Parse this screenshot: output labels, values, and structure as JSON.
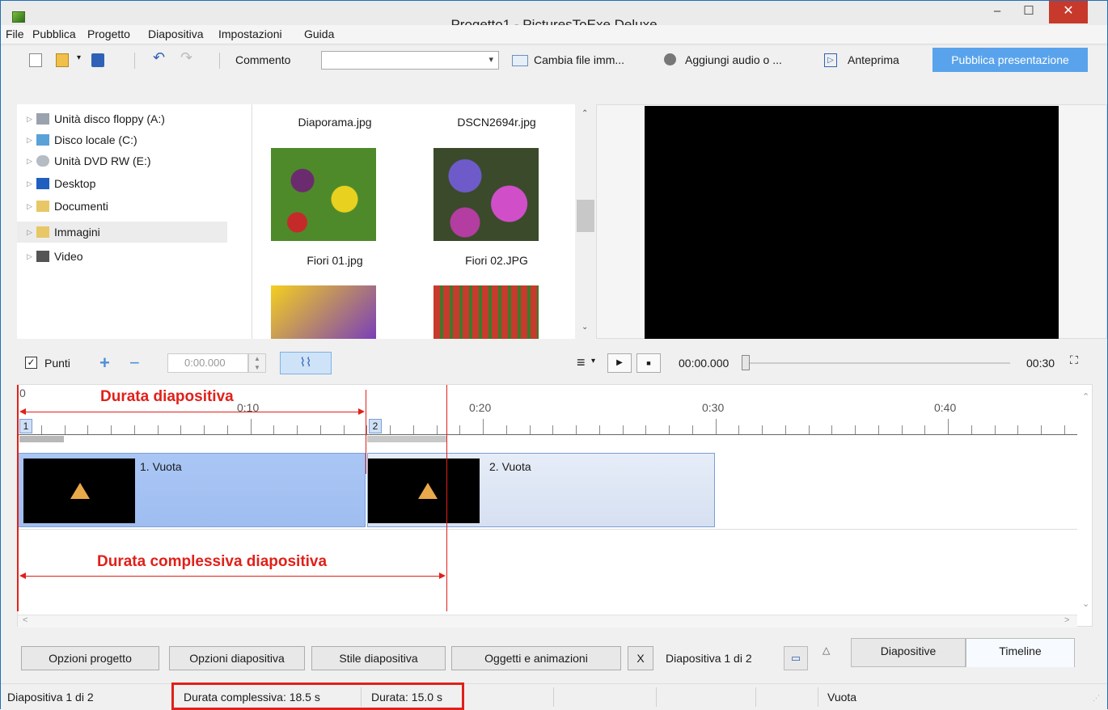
{
  "window": {
    "title": "Progetto1 - PicturesToExe Deluxe",
    "minimize": "–",
    "maximize": "☐",
    "close": "✕"
  },
  "menu": [
    "File",
    "Pubblica",
    "Progetto",
    "Diapositiva",
    "Impostazioni",
    "Guida"
  ],
  "toolbar": {
    "comment_label": "Commento",
    "comment_value": "",
    "change_file": "Cambia file imm...",
    "add_audio": "Aggiungi audio o ...",
    "preview": "Anteprima",
    "publish": "Pubblica presentazione"
  },
  "tree": [
    {
      "label": "Unità disco floppy (A:)",
      "icon": "floppy-icon"
    },
    {
      "label": "Disco locale (C:)",
      "icon": "drive-icon"
    },
    {
      "label": "Unità DVD RW (E:)",
      "icon": "dvd-icon"
    },
    {
      "label": "Desktop",
      "icon": "desktop-icon"
    },
    {
      "label": "Documenti",
      "icon": "documents-icon"
    },
    {
      "label": "Immagini",
      "icon": "pictures-icon",
      "selected": true
    },
    {
      "label": "Video",
      "icon": "video-icon"
    }
  ],
  "files": [
    {
      "name": "Diaporama.jpg"
    },
    {
      "name": "DSCN2694r.jpg"
    },
    {
      "name": "Fiori 01.jpg"
    },
    {
      "name": "Fiori 02.JPG"
    }
  ],
  "controls": {
    "points_label": "Punti",
    "points_checked": true,
    "time_value": "0:00.000",
    "current_time": "00:00.000",
    "total_time": "00:30"
  },
  "timeline": {
    "ruler_labels": [
      "0",
      "0:10",
      "0:20",
      "0:30",
      "0:40"
    ],
    "slide_markers": [
      "1",
      "2"
    ],
    "slides": [
      {
        "caption": "1. Vuota"
      },
      {
        "caption": "2. Vuota"
      }
    ],
    "annotations": {
      "slide_duration": "Durata diapositiva",
      "total_duration": "Durata complessiva diapositiva"
    }
  },
  "buttons": {
    "project_options": "Opzioni progetto",
    "slide_options": "Opzioni diapositiva",
    "slide_style": "Stile diapositiva",
    "objects_animations": "Oggetti e animazioni",
    "x": "X",
    "slide_counter": "Diapositiva 1 di 2",
    "tab_slides": "Diapositive",
    "tab_timeline": "Timeline"
  },
  "status": {
    "slide": "Diapositiva 1 di 2",
    "total_duration": "Durata complessiva: 18.5 s",
    "duration": "Durata: 15.0 s",
    "name": "Vuota"
  },
  "colors": {
    "accent": "#59a3ec",
    "annotation": "#e0201a",
    "slide_selected": "#a9c6f5",
    "slide_normal": "#dbe4f4"
  }
}
